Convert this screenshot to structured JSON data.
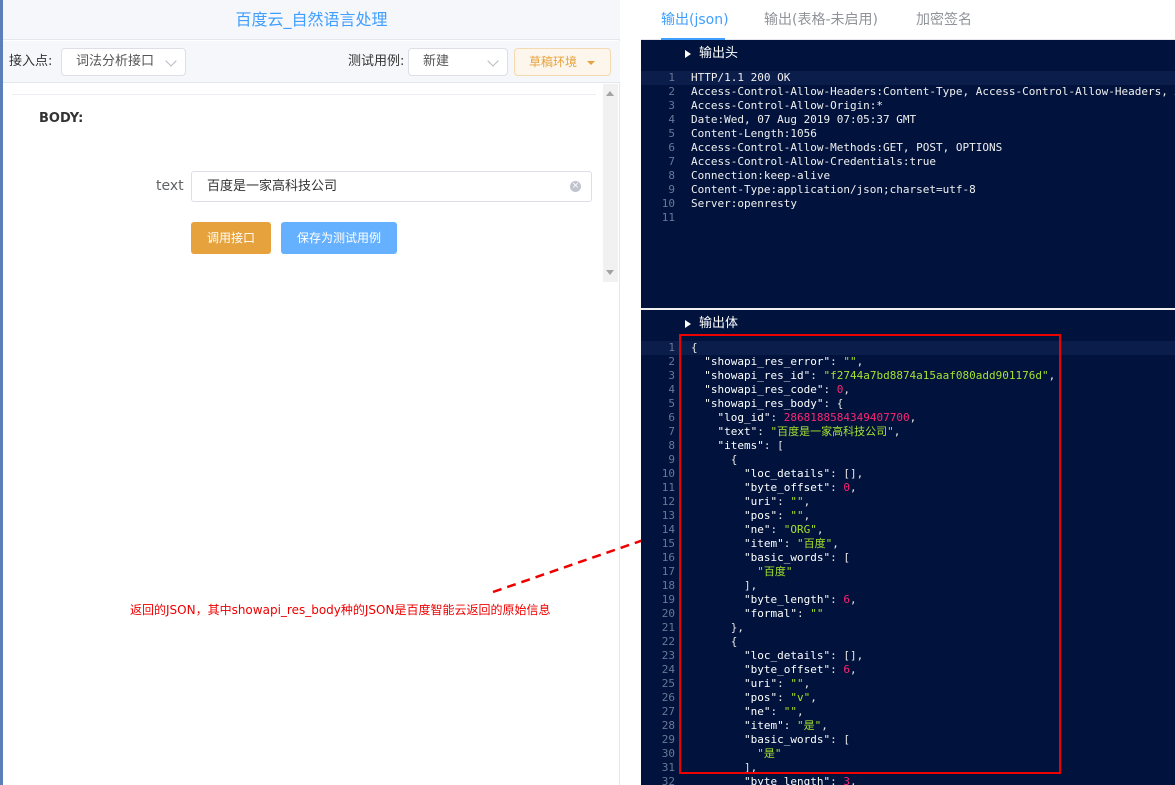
{
  "left": {
    "title": "百度云_自然语言处理",
    "toolbar": {
      "endpoint_label": "接入点:",
      "endpoint_value": "词法分析接口",
      "testcase_label": "测试用例:",
      "testcase_value": "新建",
      "draft_label": "草稿环境"
    },
    "form": {
      "body_label": "BODY:",
      "text_label": "text",
      "text_value": "百度是一家高科技公司",
      "call_button": "调用接口",
      "save_button": "保存为测试用例"
    }
  },
  "annotation": "返回的JSON，其中showapi_res_body种的JSON是百度智能云返回的原始信息",
  "right": {
    "tabs": [
      "输出(json)",
      "输出(表格-未启用)",
      "加密签名"
    ],
    "header_section": "输出头",
    "body_section": "输出体",
    "header_lines": [
      "HTTP/1.1 200 OK",
      "Access-Control-Allow-Headers:Content-Type, Access-Control-Allow-Headers, A",
      "Access-Control-Allow-Origin:*",
      "Date:Wed, 07 Aug 2019 07:05:37 GMT",
      "Content-Length:1056",
      "Access-Control-Allow-Methods:GET, POST, OPTIONS",
      "Access-Control-Allow-Credentials:true",
      "Connection:keep-alive",
      "Content-Type:application/json;charset=utf-8",
      "Server:openresty",
      ""
    ],
    "body_lines": [
      [
        [
          "p",
          "{"
        ]
      ],
      [
        [
          "p",
          "  "
        ],
        [
          "k",
          "\"showapi_res_error\""
        ],
        [
          "p",
          ": "
        ],
        [
          "s",
          "\"\""
        ],
        [
          "p",
          ","
        ]
      ],
      [
        [
          "p",
          "  "
        ],
        [
          "k",
          "\"showapi_res_id\""
        ],
        [
          "p",
          ": "
        ],
        [
          "s",
          "\"f2744a7bd8874a15aaf080add901176d\""
        ],
        [
          "p",
          ","
        ]
      ],
      [
        [
          "p",
          "  "
        ],
        [
          "k",
          "\"showapi_res_code\""
        ],
        [
          "p",
          ": "
        ],
        [
          "n",
          "0"
        ],
        [
          "p",
          ","
        ]
      ],
      [
        [
          "p",
          "  "
        ],
        [
          "k",
          "\"showapi_res_body\""
        ],
        [
          "p",
          ": {"
        ]
      ],
      [
        [
          "p",
          "    "
        ],
        [
          "k",
          "\"log_id\""
        ],
        [
          "p",
          ": "
        ],
        [
          "n",
          "2868188584349407700"
        ],
        [
          "p",
          ","
        ]
      ],
      [
        [
          "p",
          "    "
        ],
        [
          "k",
          "\"text\""
        ],
        [
          "p",
          ": "
        ],
        [
          "s",
          "\"百度是一家高科技公司\""
        ],
        [
          "p",
          ","
        ]
      ],
      [
        [
          "p",
          "    "
        ],
        [
          "k",
          "\"items\""
        ],
        [
          "p",
          ": ["
        ]
      ],
      [
        [
          "p",
          "      {"
        ]
      ],
      [
        [
          "p",
          "        "
        ],
        [
          "k",
          "\"loc_details\""
        ],
        [
          "p",
          ": [],"
        ]
      ],
      [
        [
          "p",
          "        "
        ],
        [
          "k",
          "\"byte_offset\""
        ],
        [
          "p",
          ": "
        ],
        [
          "n",
          "0"
        ],
        [
          "p",
          ","
        ]
      ],
      [
        [
          "p",
          "        "
        ],
        [
          "k",
          "\"uri\""
        ],
        [
          "p",
          ": "
        ],
        [
          "s",
          "\"\""
        ],
        [
          "p",
          ","
        ]
      ],
      [
        [
          "p",
          "        "
        ],
        [
          "k",
          "\"pos\""
        ],
        [
          "p",
          ": "
        ],
        [
          "s",
          "\"\""
        ],
        [
          "p",
          ","
        ]
      ],
      [
        [
          "p",
          "        "
        ],
        [
          "k",
          "\"ne\""
        ],
        [
          "p",
          ": "
        ],
        [
          "s",
          "\"ORG\""
        ],
        [
          "p",
          ","
        ]
      ],
      [
        [
          "p",
          "        "
        ],
        [
          "k",
          "\"item\""
        ],
        [
          "p",
          ": "
        ],
        [
          "s",
          "\"百度\""
        ],
        [
          "p",
          ","
        ]
      ],
      [
        [
          "p",
          "        "
        ],
        [
          "k",
          "\"basic_words\""
        ],
        [
          "p",
          ": ["
        ]
      ],
      [
        [
          "p",
          "          "
        ],
        [
          "s",
          "\"百度\""
        ]
      ],
      [
        [
          "p",
          "        ],"
        ]
      ],
      [
        [
          "p",
          "        "
        ],
        [
          "k",
          "\"byte_length\""
        ],
        [
          "p",
          ": "
        ],
        [
          "n",
          "6"
        ],
        [
          "p",
          ","
        ]
      ],
      [
        [
          "p",
          "        "
        ],
        [
          "k",
          "\"formal\""
        ],
        [
          "p",
          ": "
        ],
        [
          "s",
          "\"\""
        ]
      ],
      [
        [
          "p",
          "      },"
        ]
      ],
      [
        [
          "p",
          "      {"
        ]
      ],
      [
        [
          "p",
          "        "
        ],
        [
          "k",
          "\"loc_details\""
        ],
        [
          "p",
          ": [],"
        ]
      ],
      [
        [
          "p",
          "        "
        ],
        [
          "k",
          "\"byte_offset\""
        ],
        [
          "p",
          ": "
        ],
        [
          "n",
          "6"
        ],
        [
          "p",
          ","
        ]
      ],
      [
        [
          "p",
          "        "
        ],
        [
          "k",
          "\"uri\""
        ],
        [
          "p",
          ": "
        ],
        [
          "s",
          "\"\""
        ],
        [
          "p",
          ","
        ]
      ],
      [
        [
          "p",
          "        "
        ],
        [
          "k",
          "\"pos\""
        ],
        [
          "p",
          ": "
        ],
        [
          "s",
          "\"v\""
        ],
        [
          "p",
          ","
        ]
      ],
      [
        [
          "p",
          "        "
        ],
        [
          "k",
          "\"ne\""
        ],
        [
          "p",
          ": "
        ],
        [
          "s",
          "\"\""
        ],
        [
          "p",
          ","
        ]
      ],
      [
        [
          "p",
          "        "
        ],
        [
          "k",
          "\"item\""
        ],
        [
          "p",
          ": "
        ],
        [
          "s",
          "\"是\""
        ],
        [
          "p",
          ","
        ]
      ],
      [
        [
          "p",
          "        "
        ],
        [
          "k",
          "\"basic_words\""
        ],
        [
          "p",
          ": ["
        ]
      ],
      [
        [
          "p",
          "          "
        ],
        [
          "s",
          "\"是\""
        ]
      ],
      [
        [
          "p",
          "        ],"
        ]
      ],
      [
        [
          "p",
          "        "
        ],
        [
          "k",
          "\"byte_length\""
        ],
        [
          "p",
          ": "
        ],
        [
          "n",
          "3"
        ],
        [
          "p",
          ","
        ]
      ]
    ]
  }
}
